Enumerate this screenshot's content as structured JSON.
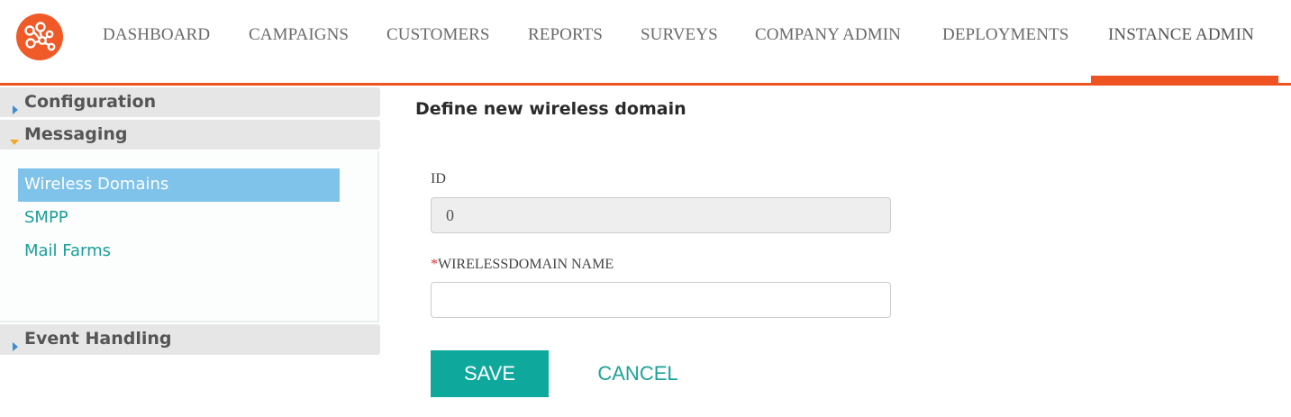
{
  "nav": {
    "logo_icon": "network-nodes-logo",
    "items": [
      "DASHBOARD",
      "CAMPAIGNS",
      "CUSTOMERS",
      "REPORTS",
      "SURVEYS",
      "COMPANY ADMIN",
      "DEPLOYMENTS",
      "INSTANCE ADMIN"
    ],
    "active_item": "INSTANCE ADMIN",
    "accent_color": "#f05322"
  },
  "sidebar": {
    "sections": [
      {
        "label": "Configuration",
        "expanded": false
      },
      {
        "label": "Messaging",
        "expanded": true
      },
      {
        "label": "Event Handling",
        "expanded": false
      }
    ],
    "messaging_items": [
      "Wireless Domains",
      "SMPP",
      "Mail Farms"
    ],
    "active_item": "Wireless Domains"
  },
  "form": {
    "title": "Define new wireless domain",
    "id_label": "ID",
    "id_value": "0",
    "required_mark": "*",
    "name_label": "WIRELESSDOMAIN NAME",
    "name_value": "",
    "save_label": "SAVE",
    "cancel_label": "CANCEL"
  }
}
